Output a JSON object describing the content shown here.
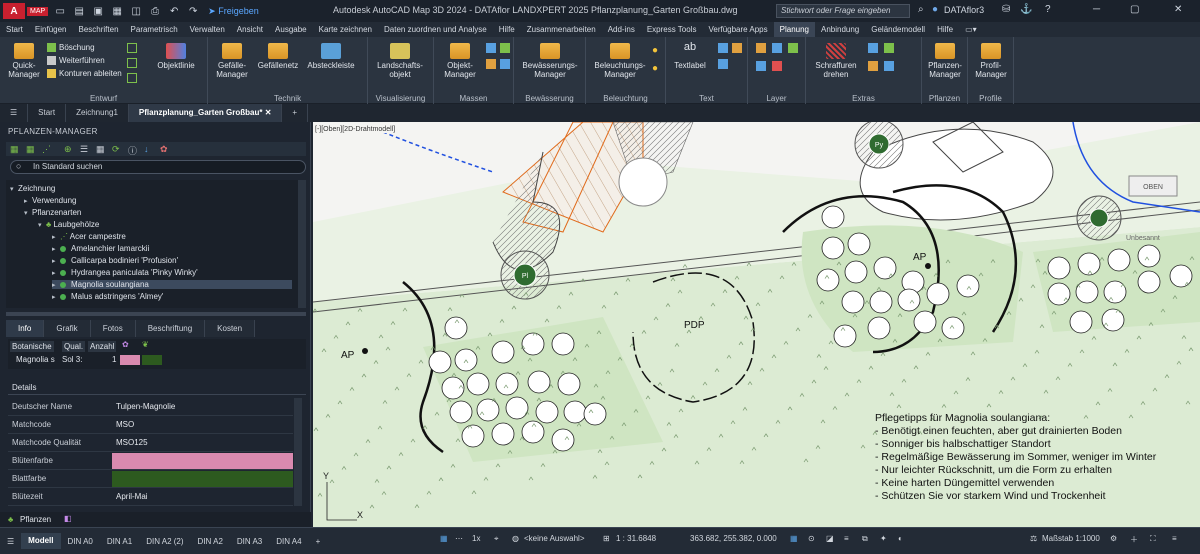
{
  "app": {
    "logo": "A",
    "version": "MAP",
    "title": "Autodesk AutoCAD Map 3D 2024 - DATAflor LANDXPERT 2025   Pflanzplanung_Garten Großbau.dwg",
    "search_placeholder": "Stichwort oder Frage eingeben",
    "user": "DATAflor3",
    "share": "Freigeben"
  },
  "menu": [
    "Start",
    "Einfügen",
    "Beschriften",
    "Parametrisch",
    "Verwalten",
    "Ansicht",
    "Ausgabe",
    "Karte zeichnen",
    "Daten zuordnen und Analyse",
    "Hilfe",
    "Zusammenarbeiten",
    "Add-ins",
    "Express Tools",
    "Verfügbare Apps",
    "Planung",
    "Anbindung",
    "Geländemodell",
    "Hilfe"
  ],
  "menu_active": "Planung",
  "ribbon": {
    "entwurf": {
      "label": "Entwurf",
      "quick": "Quick-Manager",
      "boeschung": "Böschung",
      "weiter": "Weiterführen",
      "konturen": "Konturen ableiten",
      "objektlinie": "Objektlinie"
    },
    "technik": {
      "label": "Technik",
      "gefaelle": "Gefälle-Manager",
      "gefaellenetz": "Gefällenetz",
      "absteck": "Absteckleiste"
    },
    "visual": {
      "label": "Visualisierung",
      "landschaft": "Landschafts-objekt"
    },
    "massen": {
      "label": "Massen",
      "objekt": "Objekt-Manager"
    },
    "bew": {
      "label": "Bewässerung",
      "manager": "Bewässerungs-Manager"
    },
    "bel": {
      "label": "Beleuchtung",
      "manager": "Beleuchtungs-Manager"
    },
    "text": {
      "label": "Text",
      "textlabel": "Textlabel"
    },
    "layer": {
      "label": "Layer"
    },
    "extras": {
      "label": "Extras",
      "schraffur": "Schraffuren drehen"
    },
    "pflanzen": {
      "label": "Pflanzen",
      "manager": "Pflanzen-Manager"
    },
    "profile": {
      "label": "Profile",
      "manager": "Profil-Manager"
    }
  },
  "doc_tabs": [
    "Start",
    "Zeichnung1",
    "Pflanzplanung_Garten Großbau*"
  ],
  "doc_tab_active": "Pflanzplanung_Garten Großbau*",
  "panel": {
    "title": "PFLANZEN-MANAGER",
    "search": "In Standard suchen",
    "tree": {
      "root": "Zeichnung",
      "verwendung": "Verwendung",
      "pflanzenarten": "Pflanzenarten",
      "laubgehoelze": "Laubgehölze",
      "plants": [
        "Acer campestre",
        "Amelanchier lamarckii",
        "Callicarpa bodinieri 'Profusion'",
        "Hydrangea paniculata 'Pinky Winky'",
        "Magnolia soulangiana",
        "Malus adstringens 'Almey'"
      ],
      "selected": "Magnolia soulangiana"
    },
    "tabs": [
      "Info",
      "Grafik",
      "Fotos",
      "Beschriftung",
      "Kosten"
    ],
    "tab_active": "Info",
    "grid": {
      "headers": [
        "Botanische",
        "Qual.",
        "Anzahl"
      ],
      "row": {
        "name": "Magnolia s",
        "qual": "Sol 3:",
        "count": "1"
      }
    },
    "details_label": "Details",
    "props": [
      {
        "key": "Deutscher Name",
        "value": "Tulpen-Magnolie"
      },
      {
        "key": "Matchcode",
        "value": "MSO"
      },
      {
        "key": "Matchcode Qualität",
        "value": "MSO125"
      },
      {
        "key": "Blütenfarbe",
        "value": "",
        "color": "#d98aaf"
      },
      {
        "key": "Blattfarbe",
        "value": "",
        "color": "#2d5a1f"
      },
      {
        "key": "Blütezeit",
        "value": "April-Mai"
      }
    ],
    "bottom_tab": "Pflanzen"
  },
  "canvas": {
    "viewport_label": "[-][Oben][2D-Drahtmodell]",
    "cube_label": "OBEN",
    "unbesannt": "Unbesannt",
    "labels": {
      "ap1": "AP",
      "ap2": "AP",
      "pdp": "PDP",
      "py": "Py",
      "pl": "Pl"
    },
    "tips_title": "Pflegetipps für Magnolia soulangiana:",
    "tips": [
      "- Benötigt einen feuchten, aber gut drainierten Boden",
      "- Sonniger bis halbschattiger Standort",
      "- Regelmäßige Bewässerung im Sommer, weniger im Winter",
      "- Nur leichter Rückschnitt, um die Form zu erhalten",
      "- Keine harten Düngemittel verwenden",
      "- Schützen Sie vor starkem Wind und Trockenheit"
    ],
    "axis": {
      "x": "X",
      "y": "Y"
    }
  },
  "status": {
    "tabs": [
      "Modell",
      "DIN A0",
      "DIN A1",
      "DIN A2 (2)",
      "DIN A2",
      "DIN A3",
      "DIN A4"
    ],
    "active": "Modell",
    "selection": "<keine Auswahl>",
    "scale": "1 : 31.6848",
    "coords": "363.682, 255.382, 0.000",
    "massstab": "Maßstab 1:1000",
    "zoom": "1x"
  },
  "colors": {
    "accent": "#3b82d6",
    "planting": "#d9ead0",
    "pink": "#d98aaf",
    "leaf": "#2d5a1f"
  }
}
